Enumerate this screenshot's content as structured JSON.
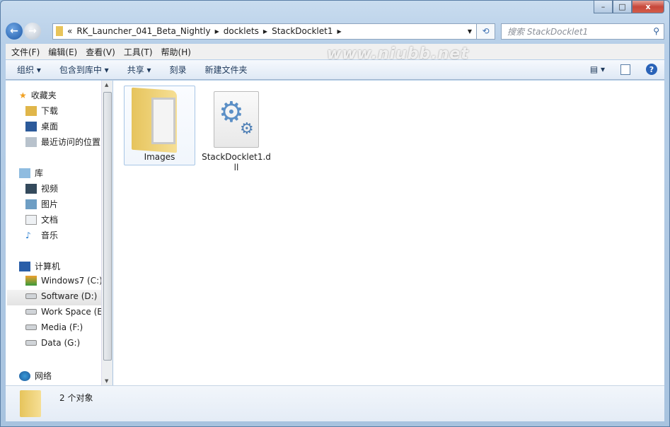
{
  "window": {
    "minimize": "–",
    "maximize": "□",
    "close": "x"
  },
  "address": {
    "prefix": "«",
    "segments": [
      "RK_Launcher_041_Beta_Nightly",
      "docklets",
      "StackDocklet1"
    ],
    "search_placeholder": "搜索 StackDocklet1"
  },
  "menu": [
    "文件(F)",
    "编辑(E)",
    "查看(V)",
    "工具(T)",
    "帮助(H)"
  ],
  "toolbar": {
    "organize": "组织 ▾",
    "include": "包含到库中 ▾",
    "share": "共享 ▾",
    "burn": "刻录",
    "new_folder": "新建文件夹"
  },
  "watermark": "www.niubb.net",
  "nav": {
    "favorites": {
      "label": "收藏夹",
      "items": [
        "下载",
        "桌面",
        "最近访问的位置"
      ]
    },
    "libraries": {
      "label": "库",
      "items": [
        "视频",
        "图片",
        "文档",
        "音乐"
      ]
    },
    "computer": {
      "label": "计算机",
      "items": [
        "Windows7 (C:)",
        "Software (D:)",
        "Work Space (E:",
        "Media (F:)",
        "Data (G:)"
      ],
      "selected": "Software (D:)"
    },
    "network": {
      "label": "网络"
    }
  },
  "files": [
    {
      "name": "Images",
      "type": "folder",
      "selected": true
    },
    {
      "name": "StackDocklet1.dll",
      "type": "dll"
    }
  ],
  "status": {
    "count": "2 个对象"
  }
}
